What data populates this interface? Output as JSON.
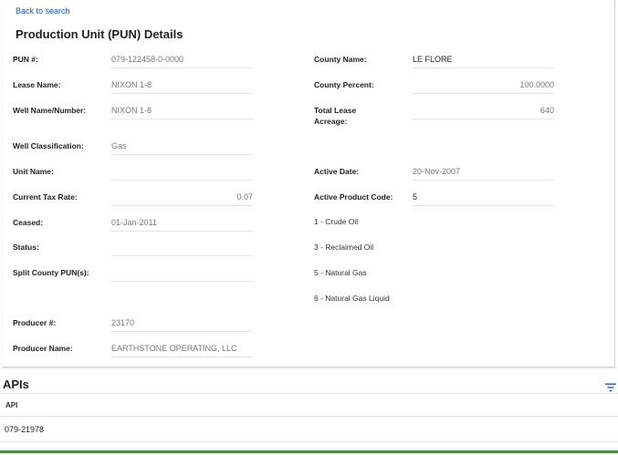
{
  "back_link": "Back to search",
  "title": "Production Unit (PUN) Details",
  "left_fields": [
    {
      "label": "PUN #:",
      "value": "079-122458-0-0000"
    },
    {
      "label": "Lease Name:",
      "value": "NIXON 1-8"
    },
    {
      "label": "Well Name/Number:",
      "value": "NIXON 1-8"
    },
    {
      "label": "Well Classification:",
      "value": "Gas"
    },
    {
      "label": "Unit Name:",
      "value": ""
    },
    {
      "label": "Current Tax Rate:",
      "value": "0.07"
    },
    {
      "label": "Ceased:",
      "value": "01-Jan-2011"
    },
    {
      "label": "Status:",
      "value": ""
    },
    {
      "label": "Split County PUN(s):",
      "value": ""
    },
    {
      "label": "Producer #:",
      "value": "23170"
    },
    {
      "label": "Producer Name:",
      "value": "EARTHSTONE OPERATING, LLC"
    }
  ],
  "right_fields": [
    {
      "label": "County Name:",
      "value": "LE FLORE"
    },
    {
      "label": "County Percent:",
      "value": "100.0000"
    },
    {
      "label_line1": "Total Lease",
      "label_line2": "Acreage:",
      "value": "640"
    },
    {
      "label": "Active Date:",
      "value": "20-Nov-2007"
    },
    {
      "label": "Active Product Code:",
      "value": "5"
    }
  ],
  "product_codes": [
    "1 - Crude Oil",
    "3 - Reclaimed Oil",
    "5 - Natural Gas",
    "6 - Natural Gas Liquid"
  ],
  "apis": {
    "title": "APIs",
    "filter_icon": "filter-icon",
    "columns": [
      "API"
    ],
    "rows": [
      [
        "079-21978"
      ]
    ]
  },
  "colors": {
    "link": "#1a56b0",
    "accent_bar": "#4f8a3a",
    "filter_icon": "#1a56b0"
  }
}
